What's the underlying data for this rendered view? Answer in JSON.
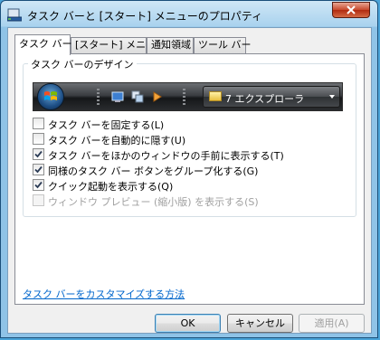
{
  "window": {
    "title": "タスク バーと [スタート] メニューのプロパティ"
  },
  "tabs": [
    {
      "label": "タスク バー",
      "active": true
    },
    {
      "label": "[スタート] メニュー",
      "active": false
    },
    {
      "label": "通知領域",
      "active": false
    },
    {
      "label": "ツール バー",
      "active": false
    }
  ],
  "appearance_group": {
    "label": "タスク バーのデザイン",
    "taskbar_button_label": "7 エクスプローラ"
  },
  "options": [
    {
      "label": "タスク バーを固定する(L)",
      "checked": false,
      "enabled": true
    },
    {
      "label": "タスク バーを自動的に隠す(U)",
      "checked": false,
      "enabled": true
    },
    {
      "label": "タスク バーをほかのウィンドウの手前に表示する(T)",
      "checked": true,
      "enabled": true
    },
    {
      "label": "同様のタスク バー ボタンをグループ化する(G)",
      "checked": true,
      "enabled": true
    },
    {
      "label": "クイック起動を表示する(Q)",
      "checked": true,
      "enabled": true
    },
    {
      "label": "ウィンドウ プレビュー (縮小版) を表示する(S)",
      "checked": false,
      "enabled": false
    }
  ],
  "customize_link": "タスク バーをカスタマイズする方法",
  "buttons": {
    "ok": "OK",
    "cancel": "キャンセル",
    "apply": "適用(A)"
  },
  "colors": {
    "link": "#0066cc",
    "title_bar": "#a9d2ee",
    "close_button": "#c8482c"
  }
}
